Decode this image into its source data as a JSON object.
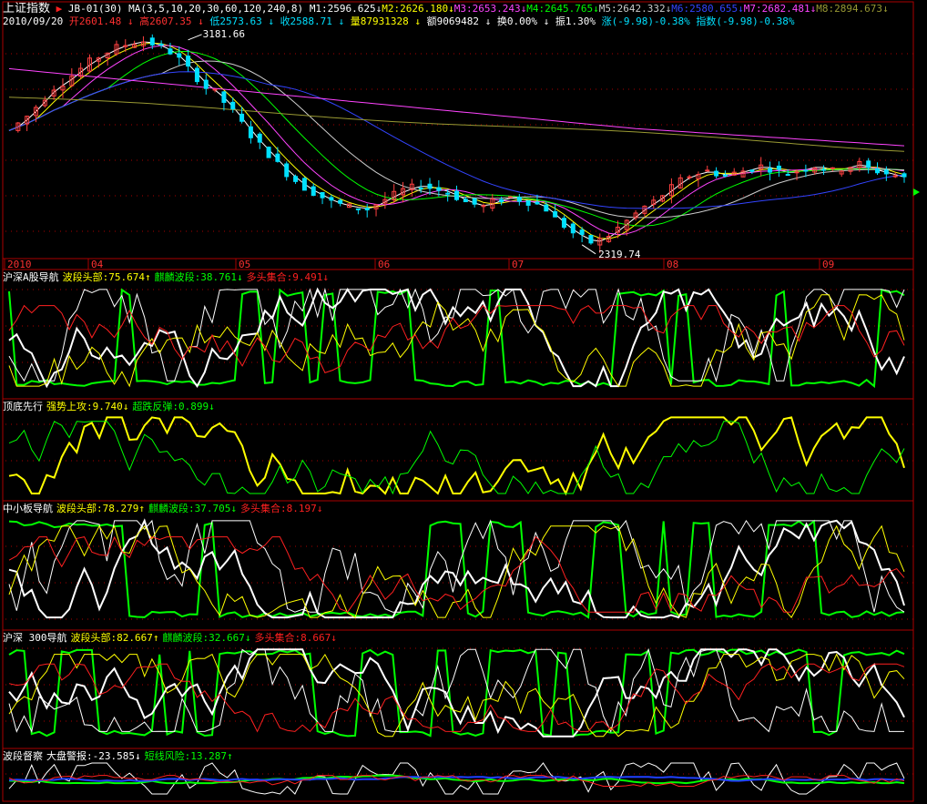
{
  "header": {
    "index_name": "上证指数",
    "formula": "JB-01(30)",
    "ma_label": "MA(3,5,10,20,30,60,120,240,8)",
    "ma_values": [
      {
        "label": "M1:2596.625",
        "color": "#ffffff"
      },
      {
        "label": "M2:2626.180",
        "color": "#ffff00"
      },
      {
        "label": "M3:2653.243",
        "color": "#ff44ff"
      },
      {
        "label": "M4:2645.765",
        "color": "#00ff00"
      },
      {
        "label": "M5:2642.332",
        "color": "#cccccc"
      },
      {
        "label": "M6:2580.655",
        "color": "#3344ff"
      },
      {
        "label": "M7:2682.481",
        "color": "#ff44ff"
      },
      {
        "label": "M8:2894.673",
        "color": "#999933"
      }
    ]
  },
  "quote": {
    "date": "2010/09/20",
    "open": "开2601.48",
    "high": "高2607.35",
    "low": "低2573.63",
    "close": "收2588.71",
    "volume": "量87931328",
    "amount": "额9069482",
    "turnover": "换0.00%",
    "amplitude": "振1.30%",
    "change": "涨(-9.98)-0.38%",
    "index_change": "指数(-9.98)-0.38%"
  },
  "indicator_panels": [
    {
      "title": "沪深A股导航",
      "items": [
        {
          "text": "波段头部:75.674",
          "color": "#ffff00",
          "arrow": "↑",
          "arrow_color": "#ffff00"
        },
        {
          "text": "麒麟波段:38.761",
          "color": "#00ff00",
          "arrow": "↓",
          "arrow_color": "#00ff00"
        },
        {
          "text": "多头集合:9.491",
          "color": "#ff2020",
          "arrow": "↓",
          "arrow_color": "#ff2020"
        }
      ]
    },
    {
      "title": "顶底先行",
      "items": [
        {
          "text": "强势上攻:9.740",
          "color": "#ffff00",
          "arrow": "↓",
          "arrow_color": "#ffff00"
        },
        {
          "text": "超跌反弹:0.899",
          "color": "#00ff00",
          "arrow": "↓",
          "arrow_color": "#00ff00"
        }
      ]
    },
    {
      "title": "中小板导航",
      "items": [
        {
          "text": "波段头部:78.279",
          "color": "#ffff00",
          "arrow": "↑",
          "arrow_color": "#ffff00"
        },
        {
          "text": "麒麟波段:37.705",
          "color": "#00ff00",
          "arrow": "↓",
          "arrow_color": "#00ff00"
        },
        {
          "text": "多头集合:8.197",
          "color": "#ff2020",
          "arrow": "↓",
          "arrow_color": "#ff2020"
        }
      ]
    },
    {
      "title": "沪深 300导航",
      "items": [
        {
          "text": "波段头部:82.667",
          "color": "#ffff00",
          "arrow": "↑",
          "arrow_color": "#ffff00"
        },
        {
          "text": "麒麟波段:32.667",
          "color": "#00ff00",
          "arrow": "↓",
          "arrow_color": "#00ff00"
        },
        {
          "text": "多头集合:8.667",
          "color": "#ff2020",
          "arrow": "↓",
          "arrow_color": "#ff2020"
        }
      ]
    },
    {
      "title": "波段督察",
      "items": [
        {
          "text": "大盘警报:-23.585",
          "color": "#ffffff",
          "arrow": "↓",
          "arrow_color": "#ffffff"
        },
        {
          "text": "短线风险:13.287",
          "color": "#00ff00",
          "arrow": "↑",
          "arrow_color": "#00ff00"
        }
      ]
    }
  ],
  "chart_data": {
    "type": "candlestick",
    "x_ticks": [
      "2010",
      "04",
      "05",
      "06",
      "07",
      "08",
      "09"
    ],
    "annotations": [
      {
        "text": "3181.66",
        "kind": "high",
        "index": 20
      },
      {
        "text": "2319.74",
        "kind": "low",
        "index": 64
      }
    ],
    "close_path": [
      2800,
      2830,
      2860,
      2900,
      2940,
      2980,
      3000,
      3030,
      3060,
      3090,
      3110,
      3130,
      3150,
      3160,
      3170,
      3175,
      3165,
      3150,
      3130,
      3100,
      3060,
      3020,
      2980,
      2960,
      2920,
      2880,
      2830,
      2780,
      2740,
      2700,
      2660,
      2620,
      2590,
      2560,
      2540,
      2520,
      2500,
      2490,
      2480,
      2475,
      2470,
      2490,
      2510,
      2530,
      2550,
      2560,
      2570,
      2560,
      2550,
      2540,
      2520,
      2500,
      2490,
      2480,
      2500,
      2510,
      2520,
      2510,
      2500,
      2490,
      2470,
      2430,
      2400,
      2370,
      2350,
      2330,
      2340,
      2360,
      2390,
      2420,
      2450,
      2480,
      2500,
      2530,
      2560,
      2590,
      2610,
      2620,
      2630,
      2620,
      2610,
      2620,
      2630,
      2640,
      2650,
      2640,
      2630,
      2620,
      2630,
      2640,
      2650,
      2640,
      2630,
      2640,
      2650,
      2660,
      2640,
      2630,
      2620,
      2610,
      2600
    ]
  },
  "colors": {
    "grid_dot": "#aa0000",
    "border": "#aa0000",
    "candle_up": "#ff4040",
    "candle_down": "#00e0ff",
    "label_red": "#ff3030",
    "label_cyan": "#00e0ff"
  }
}
